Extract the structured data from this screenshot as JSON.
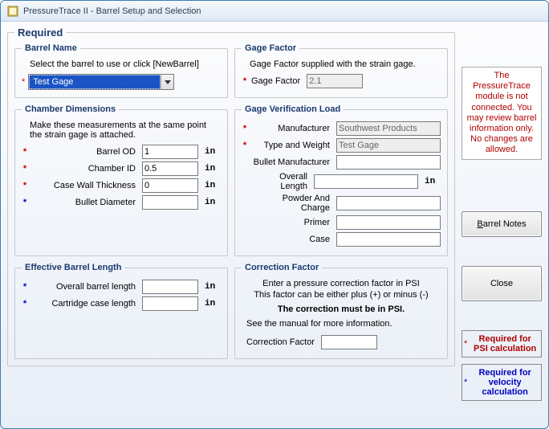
{
  "window": {
    "title": "PressureTrace II - Barrel Setup and Selection"
  },
  "outer_legend": "Required",
  "barrel_name": {
    "legend": "Barrel Name",
    "hint": "Select the barrel to use or click [NewBarrel]",
    "selected": "Test Gage"
  },
  "gage_factor": {
    "legend": "Gage Factor",
    "hint": "Gage Factor supplied with the strain gage.",
    "label": "Gage Factor",
    "value": "2.1"
  },
  "chamber": {
    "legend": "Chamber Dimensions",
    "hint": "Make these measurements at the same point the strain gage is attached.",
    "rows": [
      {
        "mark": "*",
        "color": "red",
        "label": "Barrel OD",
        "value": "1",
        "unit": "in"
      },
      {
        "mark": "*",
        "color": "red",
        "label": "Chamber ID",
        "value": "0.5",
        "unit": "in"
      },
      {
        "mark": "*",
        "color": "red",
        "label": "Case Wall Thickness",
        "value": "0",
        "unit": "in"
      },
      {
        "mark": "*",
        "color": "blue",
        "label": "Bullet Diameter",
        "value": "",
        "unit": "in"
      }
    ]
  },
  "verification": {
    "legend": "Gage Verification Load",
    "rows": [
      {
        "mark": "*",
        "color": "red",
        "label": "Manufacturer",
        "value": "Southwest Products",
        "disabled": true
      },
      {
        "mark": "*",
        "color": "red",
        "label": "Type and Weight",
        "value": "Test Gage",
        "disabled": true
      },
      {
        "mark": "",
        "color": "",
        "label": "Bullet Manufacturer",
        "value": ""
      },
      {
        "mark": "",
        "color": "",
        "label": "Overall Length",
        "value": "",
        "unit": "in"
      },
      {
        "mark": "",
        "color": "",
        "label": "Powder And Charge",
        "value": ""
      },
      {
        "mark": "",
        "color": "",
        "label": "Primer",
        "value": ""
      },
      {
        "mark": "",
        "color": "",
        "label": "Case",
        "value": ""
      }
    ]
  },
  "effective": {
    "legend": "Effective Barrel Length",
    "rows": [
      {
        "mark": "*",
        "color": "blue",
        "label": "Overall barrel length",
        "value": "",
        "unit": "in"
      },
      {
        "mark": "*",
        "color": "blue",
        "label": "Cartridge case length",
        "value": "",
        "unit": "in"
      }
    ]
  },
  "correction": {
    "legend": "Correction Factor",
    "line1": "Enter a pressure correction factor in PSI",
    "line2": "This factor can be either plus (+) or minus (-)",
    "bold": "The correction must be in PSI.",
    "line3": "See the manual for more information.",
    "label": "Correction Factor",
    "value": ""
  },
  "right": {
    "warning": "The PressureTrace module is not connected.  You may review barrel information only.  No changes are allowed.",
    "notes_btn": "Barrel Notes",
    "close_btn": "Close",
    "legend_psi": "Required for PSI calculation",
    "legend_vel": "Required for velocity calculation"
  }
}
